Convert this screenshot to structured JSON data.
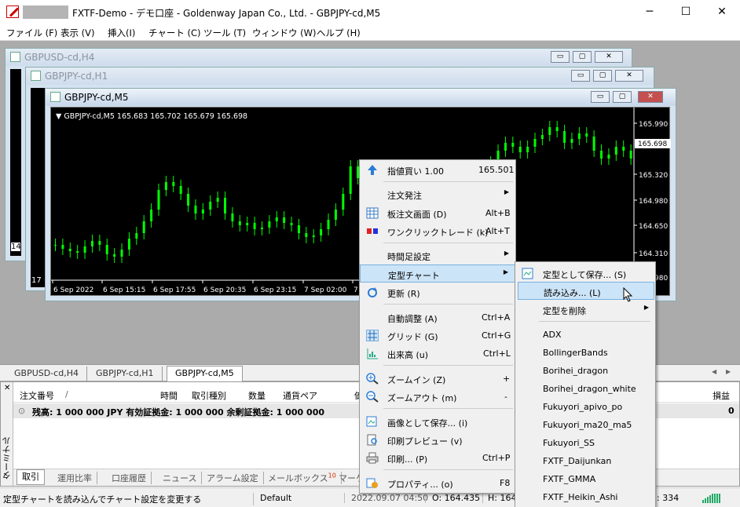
{
  "app": {
    "title": "FXTF-Demo - デモ口座 - Goldenway Japan Co., Ltd. - GBPJPY-cd,M5",
    "min": "─",
    "max": "☐",
    "close": "✕"
  },
  "menu": [
    "ファイル (F)",
    "表示 (V)",
    "挿入(I)",
    "チャート (C)",
    "ツール (T)",
    "ウィンドウ (W)",
    "ヘルプ (H)"
  ],
  "windows": {
    "w1": {
      "title": "GBPUSD-cd,H4",
      "axis": "14"
    },
    "w2": {
      "title": "GBPJPY-cd,H1",
      "axis": "17"
    },
    "w3": {
      "title": "GBPJPY-cd,M5"
    }
  },
  "chart": {
    "header": "GBPJPY-cd,M5  165.683 165.702 165.679 165.698",
    "current_price": "165.698",
    "y_ticks": [
      "165.990",
      "165.320",
      "164.980",
      "164.650",
      "164.310",
      "163.980"
    ],
    "x_ticks": [
      "6 Sep 2022",
      "6 Sep 15:15",
      "6 Sep 17:55",
      "6 Sep 20:35",
      "6 Sep 23:15",
      "7 Sep 02:00",
      "7 Sep"
    ],
    "candle_color": "#00ff00",
    "background": "#000000"
  },
  "chart_tabs": [
    "GBPUSD-cd,H4",
    "GBPJPY-cd,H1",
    "GBPJPY-cd,M5"
  ],
  "terminal": {
    "side_label": "ターミナル",
    "headers": [
      "注文番号",
      "/",
      "時間",
      "取引種別",
      "数量",
      "通貨ペア",
      "価",
      "損益"
    ],
    "balance_row": "残高: 1 000 000 JPY  有効証拠金: 1 000 000  余剰証拠金: 1 000 000",
    "balance_value": "0",
    "tabs": [
      "取引",
      "運用比率",
      "口座履歴",
      "ニュース",
      "アラーム設定",
      "メールボックス",
      "マーケ"
    ],
    "mail_badge": "10"
  },
  "status": {
    "hint": "定型チャートを読み込んでチャート設定を変更する",
    "profile": "Default",
    "time": "2022.09.07 04:50",
    "open": "O: 164.435",
    "high": "H: 164",
    "tail": ": 334"
  },
  "context_menu": {
    "limit_buy": {
      "label": "指値買い 1.00",
      "value": "165.501"
    },
    "order": "注文発注",
    "board": {
      "label": "板注文画面 (D)",
      "sc": "Alt+B"
    },
    "oneclick": {
      "label": "ワンクリックトレード (k)",
      "sc": "Alt+T"
    },
    "timeframe": "時間足設定",
    "template": "定型チャート",
    "refresh": "更新 (R)",
    "autoscroll": {
      "label": "自動調整 (A)",
      "sc": "Ctrl+A"
    },
    "grid": {
      "label": "グリッド (G)",
      "sc": "Ctrl+G"
    },
    "volumes": {
      "label": "出来高 (u)",
      "sc": "Ctrl+L"
    },
    "zoomin": {
      "label": "ズームイン (Z)",
      "sc": "+"
    },
    "zoomout": {
      "label": "ズームアウト (m)",
      "sc": "-"
    },
    "saveimg": "画像として保存... (i)",
    "preview": "印刷プレビュー (v)",
    "print": {
      "label": "印刷... (P)",
      "sc": "Ctrl+P"
    },
    "props": {
      "label": "プロパティ... (o)",
      "sc": "F8"
    }
  },
  "submenu": {
    "save": "定型として保存... (S)",
    "load": "読み込み... (L)",
    "remove": "定型を削除",
    "templates": [
      "ADX",
      "BollingerBands",
      "Borihei_dragon",
      "Borihei_dragon_white",
      "Fukuyori_apivo_po",
      "Fukuyori_ma20_ma5",
      "Fukuyori_SS",
      "FXTF_Daijunkan",
      "FXTF_GMMA",
      "FXTF_Heikin_Ashi"
    ]
  }
}
